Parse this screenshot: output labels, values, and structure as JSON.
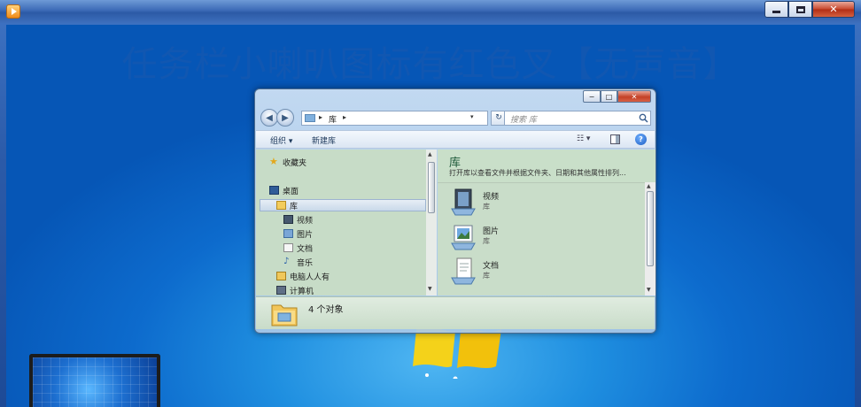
{
  "outer_window": {
    "app_icon": "media-player-icon",
    "buttons": {
      "minimize": "minimize-icon",
      "maximize": "maximize-icon",
      "close_label": "✕"
    }
  },
  "desktop": {
    "watermark": "任务栏小喇叭图标有红色叉【无声音】"
  },
  "explorer": {
    "title_buttons": {
      "minimize": "−",
      "maximize": "□",
      "close": "✕"
    },
    "nav": {
      "back": "◀",
      "forward": "▶",
      "address_label": "库",
      "arrow": "▸",
      "dropdown": "▾",
      "refresh": "↻",
      "search_placeholder": "搜索 库"
    },
    "toolbar": {
      "organize": "组织 ▾",
      "new_library": "新建库",
      "view": "☷ ▾"
    },
    "nav_pane": {
      "items": [
        {
          "label": "收藏夹",
          "icon": "star-icon"
        },
        {
          "label": "桌面",
          "icon": "desktop-icon"
        },
        {
          "label": "库",
          "icon": "library-icon"
        },
        {
          "label": "视频",
          "icon": "video-icon"
        },
        {
          "label": "图片",
          "icon": "picture-icon"
        },
        {
          "label": "文档",
          "icon": "document-icon"
        },
        {
          "label": "音乐",
          "icon": "music-icon"
        },
        {
          "label": "电脑人人有",
          "icon": "user-folder-icon"
        },
        {
          "label": "计算机",
          "icon": "computer-icon"
        }
      ]
    },
    "content": {
      "title": "库",
      "description": "打开库以查看文件并根据文件夹、日期和其他属性排列...",
      "items": [
        {
          "name": "视频",
          "type": "库",
          "icon": "video-library-icon"
        },
        {
          "name": "图片",
          "type": "库",
          "icon": "picture-library-icon"
        },
        {
          "name": "文档",
          "type": "库",
          "icon": "document-library-icon"
        }
      ]
    },
    "details": {
      "count_text": "4 个对象",
      "icon": "library-folder-icon"
    }
  },
  "colors": {
    "desktop_blue": "#0d6bcd",
    "pane_green": "#c7dcc7",
    "title_blue": "#3c6ab6",
    "close_red": "#c44127"
  }
}
